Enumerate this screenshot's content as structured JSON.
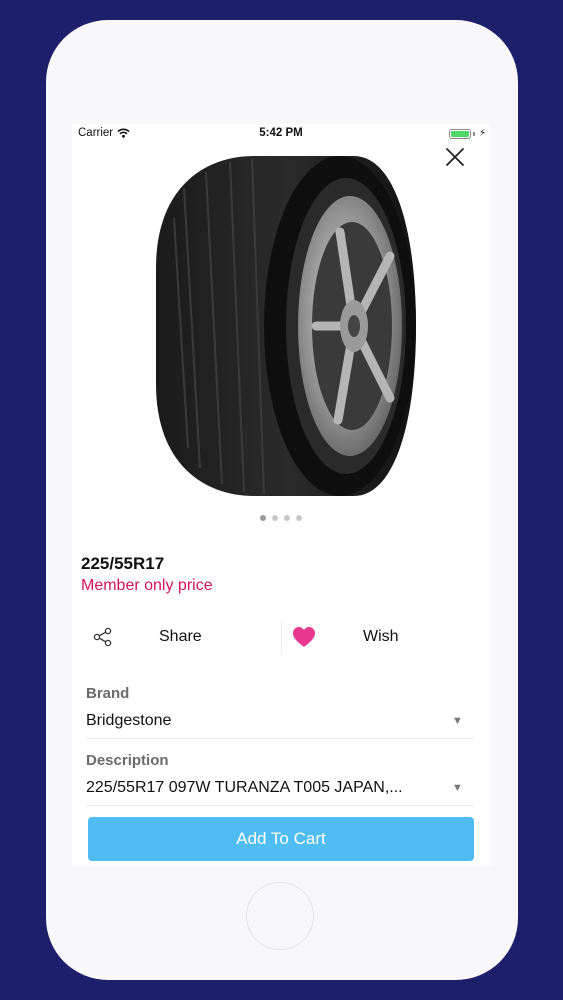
{
  "status_bar": {
    "carrier": "Carrier",
    "time": "5:42 PM"
  },
  "product": {
    "title": "225/55R17",
    "price_note": "Member only price",
    "image_pages": 4,
    "image_active_index": 0
  },
  "actions": {
    "share_label": "Share",
    "wish_label": "Wish"
  },
  "fields": {
    "brand": {
      "label": "Brand",
      "value": "Bridgestone"
    },
    "description": {
      "label": "Description",
      "value": "225/55R17 097W TURANZA T005 JAPAN,..."
    }
  },
  "cart": {
    "button_label": "Add To Cart"
  },
  "colors": {
    "background": "#1e1f6b",
    "accent_pink": "#d2145a",
    "heart": "#e8378f",
    "cart_button": "#4fbdf2"
  },
  "icons": {
    "close": "close-icon",
    "share": "share-icon",
    "wish": "heart-icon",
    "dropdown": "caret-down-icon",
    "wifi": "wifi-icon",
    "battery": "battery-icon"
  }
}
